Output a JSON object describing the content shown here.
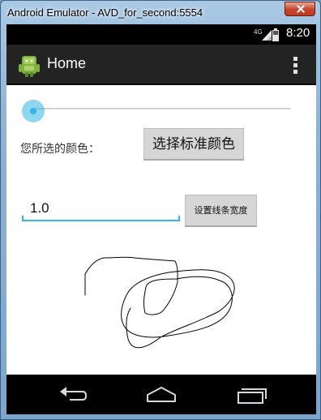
{
  "window": {
    "title": "Android Emulator - AVD_for_second:5554"
  },
  "status_bar": {
    "network": "4G",
    "time": "8:20",
    "icons": [
      "signal-icon",
      "battery-icon"
    ]
  },
  "action_bar": {
    "title": "Home",
    "icons": [
      "android-app-icon",
      "overflow-menu-icon"
    ]
  },
  "controls": {
    "seekbar_value": 0,
    "color_label": "您所选的颜色：",
    "choose_color_button": "选择标准颜色",
    "width_input_value": "1.0",
    "set_width_button": "设置线条宽度"
  },
  "colors": {
    "accent": "#33b5e5",
    "action_bar": "#232323",
    "stroke": "#000000"
  },
  "nav_bar": {
    "icons": [
      "back-icon",
      "home-icon",
      "recents-icon"
    ]
  }
}
